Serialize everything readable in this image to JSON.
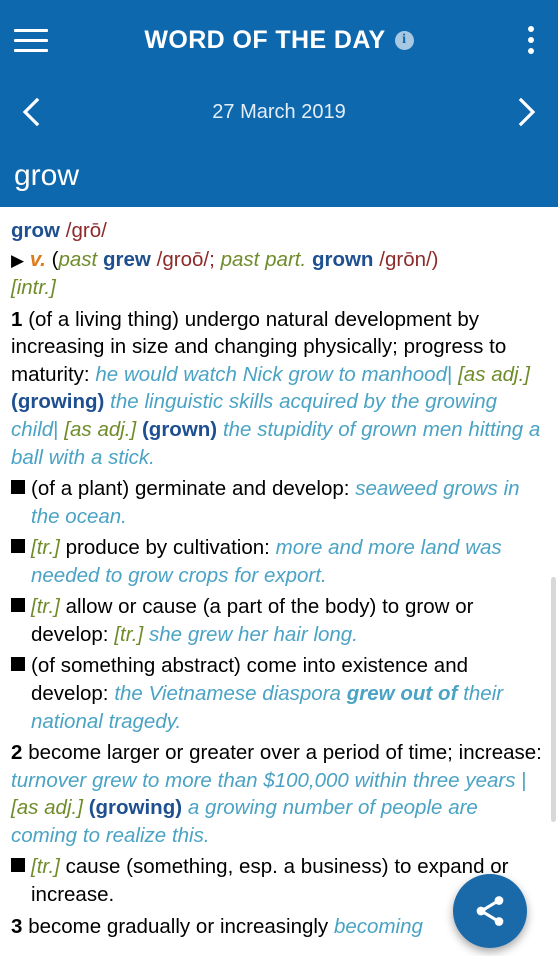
{
  "appbar": {
    "title": "WORD OF THE DAY",
    "menu_icon": "hamburger-menu-icon",
    "info_icon": "info-icon",
    "info_glyph": "i",
    "overflow_icon": "overflow-menu-icon",
    "background_color": "#0d68ae"
  },
  "date_nav": {
    "prev_icon": "chevron-left-icon",
    "next_icon": "chevron-right-icon",
    "date": "27 March 2019"
  },
  "headword_bar": {
    "word": "grow"
  },
  "entry": {
    "headword": "grow",
    "pronunciation": "/grō/",
    "triangle": "▶",
    "part_of_speech": "v.",
    "inflections_open": "(",
    "past_label": "past",
    "past_form": "grew",
    "past_pron": "/groō/;",
    "pastpart_label": "past part.",
    "pastpart_form": "grown",
    "pastpart_pron": "/grōn/)",
    "transitivity": "[intr.]",
    "senses": [
      {
        "number": "1",
        "definition": "(of a living thing) undergo natural development by increasing in size and changing physically; progress to maturity:",
        "example1": "he would watch Nick grow to manhood",
        "pipe1": "|",
        "label1": "[as adj.]",
        "infl1": "(growing)",
        "example2": "the linguistic skills acquired by the growing child",
        "pipe2": "|",
        "label2": "[as adj.]",
        "infl2": "(grown)",
        "example3": "the stupidity of grown men hitting a ball with a stick.",
        "subsenses": [
          {
            "bullet": "square-bullet",
            "label": "",
            "definition": "(of a plant) germinate and develop:",
            "example": "seaweed grows in the ocean."
          },
          {
            "bullet": "square-bullet",
            "label": "[tr.]",
            "definition": "produce by cultivation:",
            "example": "more and more land was needed to grow crops for export."
          },
          {
            "bullet": "square-bullet",
            "label": "[tr.]",
            "definition": "allow or cause (a part of the body) to grow or develop:",
            "label2": "[tr.]",
            "example": "she grew her hair long."
          },
          {
            "bullet": "square-bullet",
            "label": "",
            "definition": "(of something abstract) come into existence and develop:",
            "example_pre": "the Vietnamese diaspora ",
            "example_bold": "grew out of",
            "example_post": " their national tragedy."
          }
        ]
      },
      {
        "number": "2",
        "definition": "become larger or greater over a period of time; increase:",
        "example1": "turnover grew to more than $100,000 within three years",
        "pipe1": "|",
        "label1": "[as adj.]",
        "infl1": "(growing)",
        "example2": "a growing number of people are coming to realize this.",
        "subsenses": [
          {
            "bullet": "square-bullet",
            "label": "[tr.]",
            "definition": "cause (something, esp. a business) to expand or increase."
          }
        ]
      },
      {
        "number": "3",
        "definition": "become gradually or increasingly",
        "example": "becoming"
      }
    ]
  },
  "fab": {
    "icon": "share-icon",
    "color": "#1a6aaa"
  },
  "scrollbar": {
    "name": "vertical-scrollbar"
  }
}
